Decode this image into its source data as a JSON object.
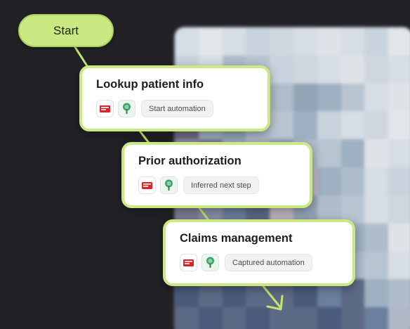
{
  "start_label": "Start",
  "steps": [
    {
      "title": "Lookup patient info",
      "tag": "Start automation",
      "icons": [
        "epic-logo-icon",
        "tree-logo-icon"
      ]
    },
    {
      "title": "Prior authorization",
      "tag": "Inferred next step",
      "icons": [
        "epic-logo-icon",
        "tree-logo-icon"
      ]
    },
    {
      "title": "Claims management",
      "tag": "Captured automation",
      "icons": [
        "epic-logo-icon",
        "tree-logo-icon"
      ]
    }
  ],
  "colors": {
    "background": "#222226",
    "accent": "#cbe983",
    "connector": "#c3e46f"
  }
}
